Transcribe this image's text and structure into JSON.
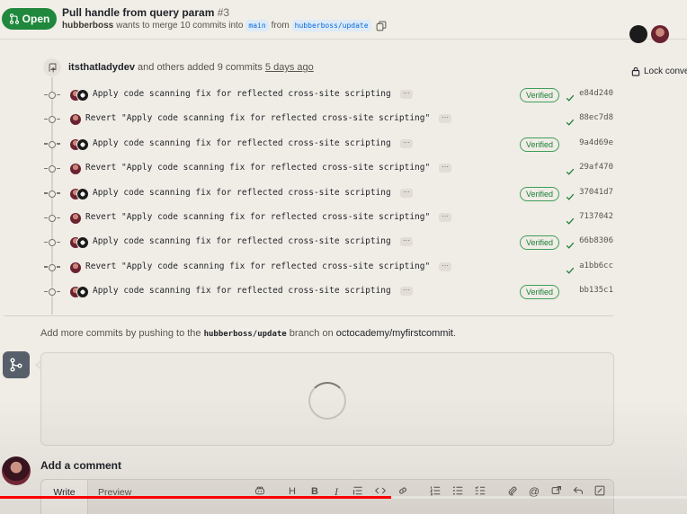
{
  "header": {
    "state_label": "Open",
    "title": "Pull handle from query param",
    "number": "#3",
    "author": "hubberboss",
    "merge_text": "wants to merge 10 commits into",
    "base_branch": "main",
    "from_text": "from",
    "head_branch": "hubberboss/update"
  },
  "sidebar": {
    "lock_label": "Lock conve"
  },
  "push_event": {
    "user": "itsthatladydev",
    "text": "and others added 9 commits",
    "time": "5 days ago"
  },
  "commits": [
    {
      "message": "Apply code scanning fix for reflected cross-site scripting",
      "sha": "e84d240",
      "verified": "Verified",
      "check": true,
      "avatars": [
        "woman",
        "cat"
      ]
    },
    {
      "message": "Revert \"Apply code scanning fix for reflected cross-site scripting\"",
      "sha": "88ec7d8",
      "verified": "",
      "check": true,
      "avatars": [
        "woman"
      ]
    },
    {
      "message": "Apply code scanning fix for reflected cross-site scripting",
      "sha": "9a4d69e",
      "verified": "Verified",
      "check": false,
      "avatars": [
        "woman",
        "cat"
      ]
    },
    {
      "message": "Revert \"Apply code scanning fix for reflected cross-site scripting\"",
      "sha": "29af470",
      "verified": "",
      "check": true,
      "avatars": [
        "woman"
      ]
    },
    {
      "message": "Apply code scanning fix for reflected cross-site scripting",
      "sha": "37041d7",
      "verified": "Verified",
      "check": true,
      "avatars": [
        "woman",
        "cat"
      ]
    },
    {
      "message": "Revert \"Apply code scanning fix for reflected cross-site scripting\"",
      "sha": "7137042",
      "verified": "",
      "check": true,
      "avatars": [
        "woman"
      ]
    },
    {
      "message": "Apply code scanning fix for reflected cross-site scripting",
      "sha": "66b8306",
      "verified": "Verified",
      "check": true,
      "avatars": [
        "woman",
        "cat"
      ]
    },
    {
      "message": "Revert \"Apply code scanning fix for reflected cross-site scripting\"",
      "sha": "a1bb6cc",
      "verified": "",
      "check": true,
      "avatars": [
        "woman"
      ]
    },
    {
      "message": "Apply code scanning fix for reflected cross-site scripting",
      "sha": "bb135c1",
      "verified": "Verified",
      "check": false,
      "avatars": [
        "woman",
        "cat"
      ]
    }
  ],
  "push_hint": {
    "prefix": "Add more commits by pushing to the",
    "branch": "hubberboss/update",
    "middle": "branch on",
    "repo": "octocademy/myfirstcommit",
    "suffix": "."
  },
  "comment": {
    "title": "Add a comment",
    "tab_write": "Write",
    "tab_preview": "Preview"
  },
  "video": {
    "progress": 0.57
  },
  "colors": {
    "open_green": "#1f883d",
    "verified_green": "#1a7f37",
    "link_blue": "#0969da",
    "progress_red": "#ff0000"
  }
}
